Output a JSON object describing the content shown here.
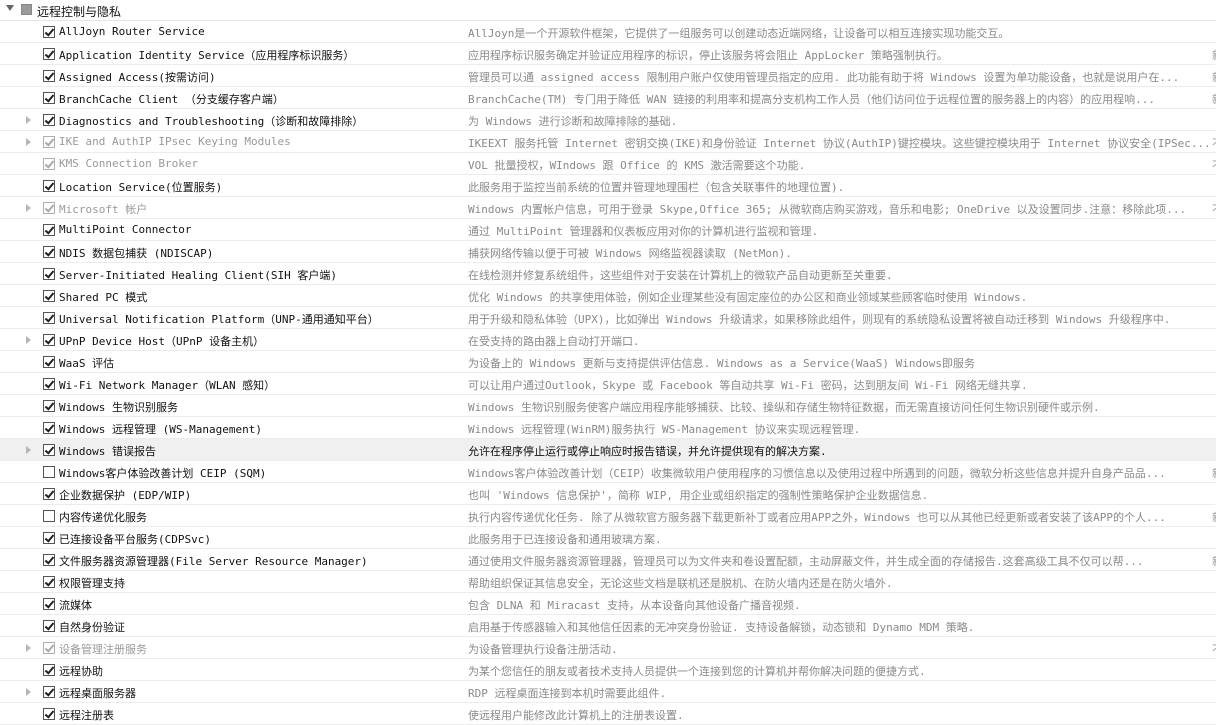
{
  "group": {
    "title": "远程控制与隐私"
  },
  "rows": [
    {
      "name": "AllJoyn Router Service",
      "desc": "AllJoyn是一个开源软件框架，它提供了一组服务可以创建动态近端网络，让设备可以相互连接实现功能交互。",
      "checked": true,
      "expander": false,
      "dim": false,
      "edge": ""
    },
    {
      "name": "Application Identity Service（应用程序标识服务）",
      "desc": "应用程序标识服务确定并验证应用程序的标识，停止该服务将会阻止 AppLocker 策略强制执行。",
      "checked": true,
      "expander": false,
      "dim": false,
      "edge": "新"
    },
    {
      "name": "Assigned Access(按需访问)",
      "desc": "管理员可以通 assigned access 限制用户账户仅使用管理员指定的应用. 此功能有助于将 Windows 设置为单功能设备，也就是说用户在...",
      "checked": true,
      "expander": false,
      "dim": false,
      "edge": "新"
    },
    {
      "name": "BranchCache Client （分支缓存客户端）",
      "desc": "BranchCache(TM) 专门用于降低 WAN 链接的利用率和提高分支机构工作人员（他们访问位于远程位置的服务器上的内容）的应用程响...",
      "checked": true,
      "expander": false,
      "dim": false,
      "edge": "新"
    },
    {
      "name": "Diagnostics and Troubleshooting（诊断和故障排除）",
      "desc": "为 Windows 进行诊断和故障排除的基础.",
      "checked": true,
      "expander": true,
      "dim": false,
      "edge": ""
    },
    {
      "name": "IKE and AuthIP IPsec Keying Modules",
      "desc": "IKEEXT 服务托管 Internet 密钥交换(IKE)和身份验证 Internet 协议(AuthIP)键控模块。这些键控模块用于 Internet 协议安全(IPSec...",
      "checked": true,
      "expander": true,
      "dim": true,
      "edge": "不"
    },
    {
      "name": "KMS Connection Broker",
      "desc": "VOL 批量授权，WIndows 跟 Office 的 KMS 激活需要这个功能.",
      "checked": true,
      "expander": false,
      "dim": true,
      "edge": "不"
    },
    {
      "name": "Location Service(位置服务)",
      "desc": "此服务用于监控当前系统的位置并管理地理围栏（包含关联事件的地理位置).",
      "checked": true,
      "expander": false,
      "dim": false,
      "edge": ""
    },
    {
      "name": "Microsoft 帐户",
      "desc": "Windows 内置帐户信息，可用于登录 Skype,Office 365; 从微软商店购买游戏，音乐和电影; OneDrive 以及设置同步.注意：移除此项...",
      "checked": true,
      "expander": true,
      "dim": true,
      "edge": "不"
    },
    {
      "name": "MultiPoint Connector",
      "desc": "通过 MultiPoint 管理器和仪表板应用对你的计算机进行监视和管理.",
      "checked": true,
      "expander": false,
      "dim": false,
      "edge": ""
    },
    {
      "name": "NDIS 数据包捕获 (NDISCAP)",
      "desc": "捕获网络传输以便于可被 Windows 网络监视器读取 (NetMon).",
      "checked": true,
      "expander": false,
      "dim": false,
      "edge": ""
    },
    {
      "name": "Server-Initiated Healing Client(SIH 客户端)",
      "desc": "在线检测并修复系统组件，这些组件对于安装在计算机上的微软产品自动更新至关重要.",
      "checked": true,
      "expander": false,
      "dim": false,
      "edge": ""
    },
    {
      "name": "Shared PC 模式",
      "desc": "优化 Windows 的共享使用体验，例如企业理某些没有固定座位的办公区和商业领域某些顾客临时使用 Windows.",
      "checked": true,
      "expander": false,
      "dim": false,
      "edge": ""
    },
    {
      "name": "Universal Notification Platform（UNP-通用通知平台）",
      "desc": "用于升级和隐私体验（UPX)，比如弹出 Windows 升级请求，如果移除此组件，则现有的系统隐私设置将被自动迁移到 Windows 升级程序中.",
      "checked": true,
      "expander": false,
      "dim": false,
      "edge": ""
    },
    {
      "name": "UPnP Device Host（UPnP 设备主机）",
      "desc": "在受支持的路由器上自动打开端口.",
      "checked": true,
      "expander": true,
      "dim": false,
      "edge": ""
    },
    {
      "name": "WaaS 评估",
      "desc": "为设备上的 Windows 更新与支持提供评估信息. Windows as a Service(WaaS) Windows即服务",
      "checked": true,
      "expander": false,
      "dim": false,
      "edge": ""
    },
    {
      "name": "Wi-Fi Network Manager（WLAN 感知）",
      "desc": "可以让用户通过Outlook，Skype 或 Facebook 等自动共享 Wi-Fi 密码，达到朋友间 Wi-Fi 网络无缝共享.",
      "checked": true,
      "expander": false,
      "dim": false,
      "edge": ""
    },
    {
      "name": "Windows 生物识别服务",
      "desc": "Windows 生物识别服务使客户端应用程序能够捕获、比较、操纵和存储生物特征数据，而无需直接访问任何生物识别硬件或示例.",
      "checked": true,
      "expander": false,
      "dim": false,
      "edge": ""
    },
    {
      "name": "Windows 远程管理 (WS-Management)",
      "desc": "Windows 远程管理(WinRM)服务执行 WS-Management 协议来实现远程管理.",
      "checked": true,
      "expander": false,
      "dim": false,
      "edge": ""
    },
    {
      "name": "Windows 错误报告",
      "desc": "允许在程序停止运行或停止响应时报告错误，并允许提供现有的解决方案.",
      "checked": true,
      "expander": true,
      "dim": false,
      "edge": "",
      "selected": true
    },
    {
      "name": "Windows客户体验改善计划 CEIP (SQM)",
      "desc": "Windows客户体验改善计划（CEIP）收集微软用户使用程序的习惯信息以及使用过程中所遇到的问题，微软分析这些信息并提升自身产品品...",
      "checked": false,
      "expander": false,
      "dim": false,
      "edge": "新"
    },
    {
      "name": "企业数据保护 (EDP/WIP)",
      "desc": "也叫 'Windows 信息保护'，简称 WIP, 用企业或组织指定的强制性策略保护企业数据信息.",
      "checked": true,
      "expander": false,
      "dim": false,
      "edge": ""
    },
    {
      "name": "内容传递优化服务",
      "desc": "执行内容传递优化任务. 除了从微软官方服务器下载更新补丁或者应用APP之外，Windows 也可以从其他已经更新或者安装了该APP的个人...",
      "checked": false,
      "expander": false,
      "dim": false,
      "edge": "新"
    },
    {
      "name": "已连接设备平台服务(CDPSvc)",
      "desc": "此服务用于已连接设备和通用玻璃方案.",
      "checked": true,
      "expander": false,
      "dim": false,
      "edge": ""
    },
    {
      "name": "文件服务器资源管理器(File Server Resource Manager)",
      "desc": "通过使用文件服务器资源管理器，管理员可以为文件夹和卷设置配额，主动屏蔽文件，并生成全面的存储报告.这套高级工具不仅可以帮...",
      "checked": true,
      "expander": false,
      "dim": false,
      "edge": "新"
    },
    {
      "name": "权限管理支持",
      "desc": "帮助组织保证其信息安全，无论这些文档是联机还是脱机、在防火墙内还是在防火墙外.",
      "checked": true,
      "expander": false,
      "dim": false,
      "edge": ""
    },
    {
      "name": "流媒体",
      "desc": "包含 DLNA 和 Miracast 支持，从本设备向其他设备广播音视频.",
      "checked": true,
      "expander": false,
      "dim": false,
      "edge": ""
    },
    {
      "name": "自然身份验证",
      "desc": "启用基于传感器输入和其他信任因素的无冲突身份验证. 支持设备解锁，动态锁和 Dynamo MDM 策略.",
      "checked": true,
      "expander": false,
      "dim": false,
      "edge": ""
    },
    {
      "name": "设备管理注册服务",
      "desc": "为设备管理执行设备注册活动.",
      "checked": true,
      "expander": true,
      "dim": true,
      "edge": "不"
    },
    {
      "name": "远程协助",
      "desc": "为某个您信任的朋友或者技术支持人员提供一个连接到您的计算机并帮你解决问题的便捷方式.",
      "checked": true,
      "expander": false,
      "dim": false,
      "edge": ""
    },
    {
      "name": "远程桌面服务器",
      "desc": "RDP 远程桌面连接到本机时需要此组件.",
      "checked": true,
      "expander": true,
      "dim": false,
      "edge": ""
    },
    {
      "name": "远程注册表",
      "desc": "使远程用户能修改此计算机上的注册表设置.",
      "checked": true,
      "expander": false,
      "dim": false,
      "edge": ""
    }
  ]
}
